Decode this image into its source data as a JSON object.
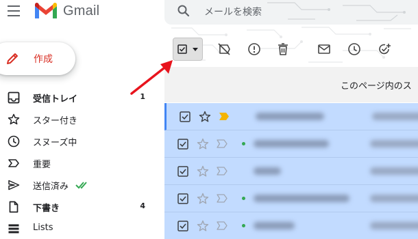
{
  "app": {
    "logo_text": "Gmail"
  },
  "compose": {
    "label": "作成"
  },
  "search": {
    "placeholder": "メールを検索"
  },
  "nav": {
    "items": [
      {
        "label": "受信トレイ",
        "count": "1",
        "bold": true,
        "icon": "inbox-icon"
      },
      {
        "label": "スター付き",
        "count": "",
        "bold": false,
        "icon": "star-icon"
      },
      {
        "label": "スヌーズ中",
        "count": "",
        "bold": false,
        "icon": "clock-icon"
      },
      {
        "label": "重要",
        "count": "",
        "bold": false,
        "icon": "label-important-icon"
      },
      {
        "label": "送信済み",
        "count": "",
        "bold": false,
        "icon": "send-icon"
      },
      {
        "label": "下書き",
        "count": "4",
        "bold": true,
        "icon": "draft-icon"
      },
      {
        "label": "Lists",
        "count": "",
        "bold": false,
        "icon": "list-icon"
      }
    ]
  },
  "toolbar": {
    "buttons": [
      "select-checkbox-dropdown",
      "mark-not-spam-icon",
      "report-spam-icon",
      "delete-icon",
      "mark-read-icon",
      "snooze-icon",
      "add-task-icon"
    ]
  },
  "notice": {
    "text": "このページ内のス"
  },
  "rows": [
    {
      "checked": true,
      "starred": false,
      "important": true,
      "unread_dot": false
    },
    {
      "checked": true,
      "starred": false,
      "important": false,
      "unread_dot": true
    },
    {
      "checked": true,
      "starred": false,
      "important": false,
      "unread_dot": false
    },
    {
      "checked": true,
      "starred": false,
      "important": false,
      "unread_dot": true
    },
    {
      "checked": true,
      "starred": false,
      "important": false,
      "unread_dot": true
    }
  ],
  "colors": {
    "selected_row": "#c2dbff",
    "compose_text": "#d93025",
    "annotation_arrow": "#e8141d",
    "important_marker": "#f4b400",
    "sent_check": "#34a853"
  }
}
